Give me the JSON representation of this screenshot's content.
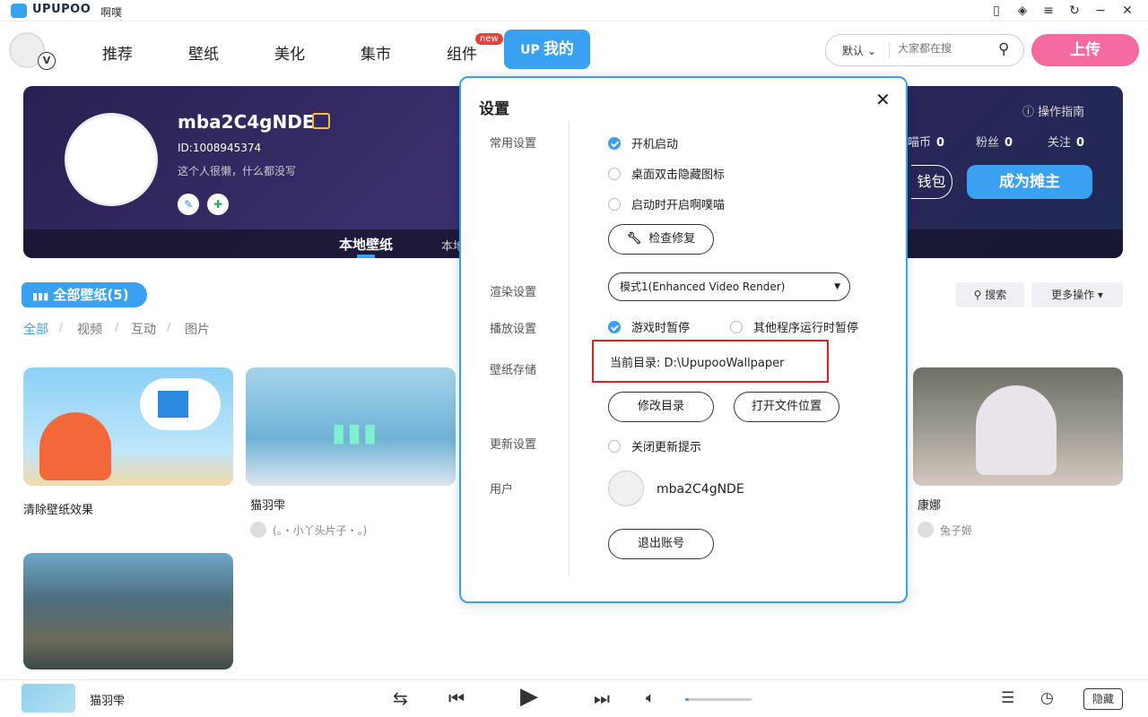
{
  "app": {
    "brand": "UPUPOO",
    "subtitle": "啊噗"
  },
  "nav": {
    "items": [
      "推荐",
      "壁纸",
      "美化",
      "集市",
      "组件"
    ],
    "new_badge": "new",
    "my_tab": "我的",
    "my_tab_logo": "UP",
    "search_select": "默认",
    "search_placeholder": "大家都在搜",
    "upload": "上传"
  },
  "profile": {
    "name": "mba2C4gNDE",
    "id": "ID:1008945374",
    "signature": "这个人很懒，什么都没写",
    "guide": "操作指南",
    "stats": [
      {
        "label": "喵币",
        "value": "0"
      },
      {
        "label": "粉丝",
        "value": "0"
      },
      {
        "label": "关注",
        "value": "0"
      }
    ],
    "wallet": "钱包",
    "become_vendor": "成为摊主",
    "tabs": [
      "本地壁纸",
      "本地"
    ]
  },
  "library": {
    "all_label": "全部壁纸(5)",
    "filters": [
      "全部",
      "视频",
      "互动",
      "图片"
    ],
    "search_btn": "搜索",
    "more_btn": "更多操作",
    "cards": [
      {
        "title": "清除壁纸效果",
        "author": ""
      },
      {
        "title": "猫羽雫",
        "author": "(。・小丫头片子・。)"
      },
      {
        "title": "康娜",
        "author": "兔子姬"
      },
      {
        "title": "",
        "author": ""
      }
    ]
  },
  "player": {
    "title": "猫羽雫",
    "volume": 0.05,
    "hide": "隐藏"
  },
  "settings": {
    "title": "设置",
    "sections": {
      "general": "常用设置",
      "render": "渲染设置",
      "playback": "播放设置",
      "storage": "壁纸存储",
      "update": "更新设置",
      "user": "用户"
    },
    "general_opts": [
      {
        "label": "开机启动",
        "checked": true
      },
      {
        "label": "桌面双击隐藏图标",
        "checked": false
      },
      {
        "label": "启动时开启啊噗喵",
        "checked": false
      }
    ],
    "repair_btn": "检查修复",
    "render_mode": "模式1(Enhanced Video Render)",
    "playback_opts": [
      {
        "label": "游戏时暂停",
        "checked": true
      },
      {
        "label": "其他程序运行时暂停",
        "checked": false
      }
    ],
    "current_dir_label": "当前目录:",
    "current_dir_value": "D:\\UpupooWallpaper",
    "change_dir_btn": "修改目录",
    "open_location_btn": "打开文件位置",
    "update_opt": {
      "label": "关闭更新提示",
      "checked": false
    },
    "username": "mba2C4gNDE",
    "logout_btn": "退出账号"
  },
  "colors": {
    "accent": "#3aa0f0",
    "pink": "#f56aa0",
    "highlight_red": "#e02020"
  }
}
